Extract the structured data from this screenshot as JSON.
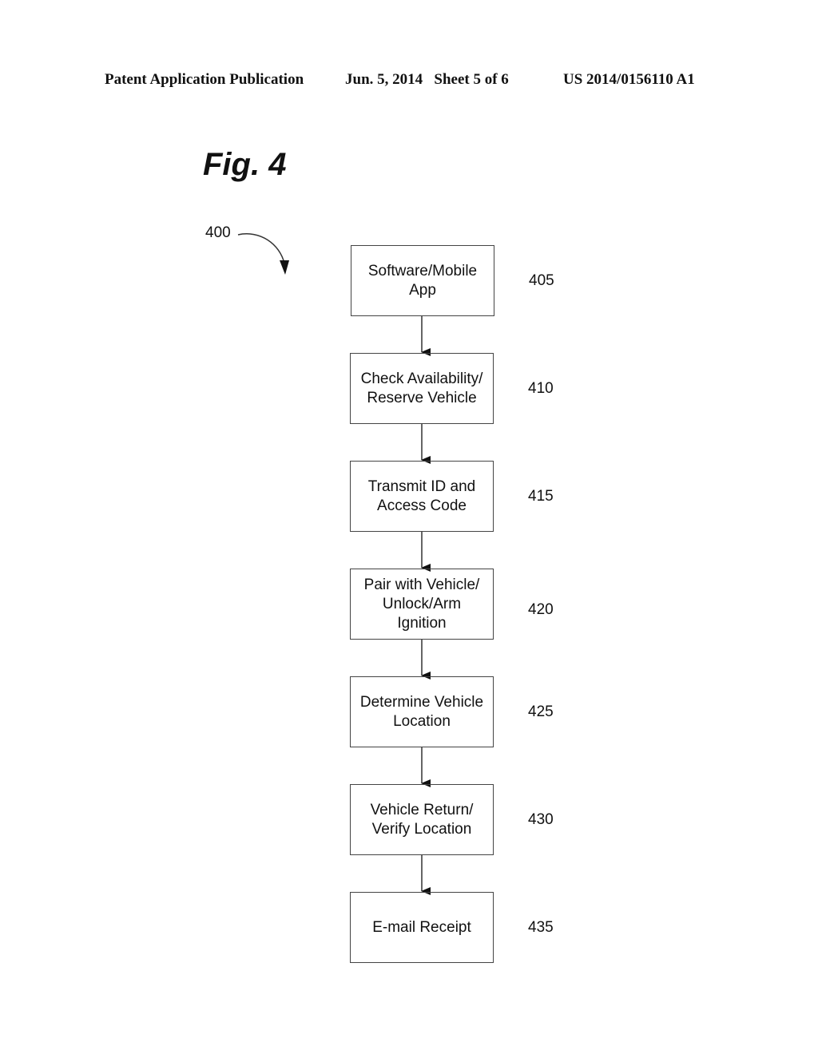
{
  "header": {
    "publication": "Patent Application Publication",
    "date_sheet": "Jun. 5, 2014   Sheet 5 of 6",
    "number": "US 2014/0156110 A1"
  },
  "figure": {
    "title": "Fig. 4",
    "reference": "400"
  },
  "flowchart": {
    "steps": [
      {
        "label": "Software/Mobile\nApp",
        "ref": "405"
      },
      {
        "label": "Check Availability/\nReserve Vehicle",
        "ref": "410"
      },
      {
        "label": "Transmit ID and\nAccess Code",
        "ref": "415"
      },
      {
        "label": "Pair with Vehicle/\nUnlock/Arm\nIgnition",
        "ref": "420"
      },
      {
        "label": "Determine Vehicle\nLocation",
        "ref": "425"
      },
      {
        "label": "Vehicle Return/\nVerify Location",
        "ref": "430"
      },
      {
        "label": "E-mail Receipt",
        "ref": "435"
      }
    ]
  }
}
